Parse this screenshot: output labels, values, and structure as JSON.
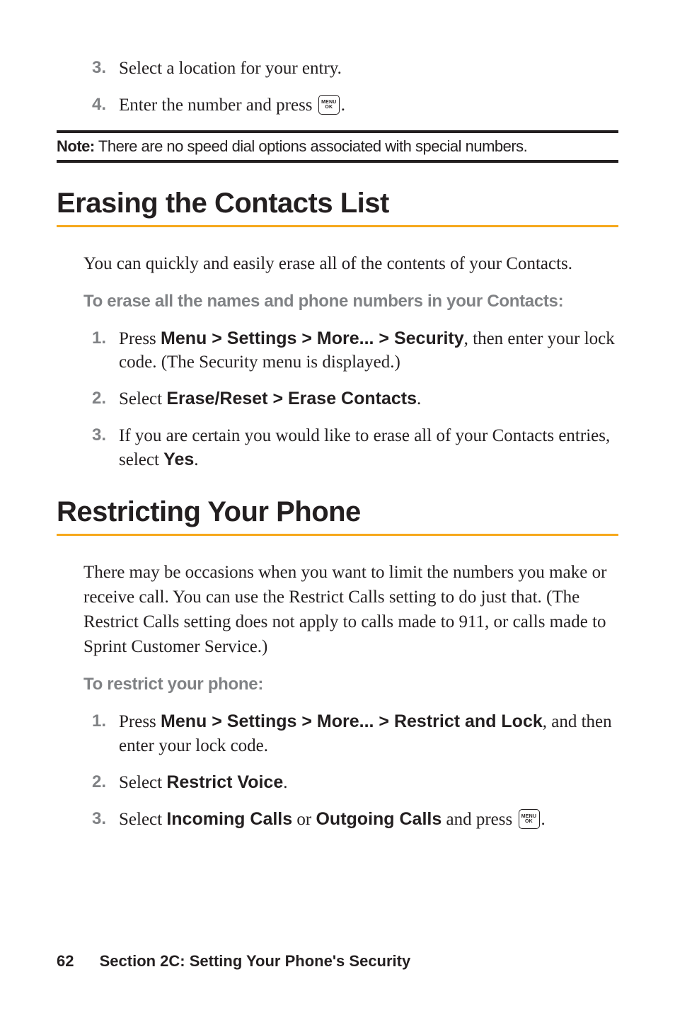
{
  "continued_steps": [
    {
      "num": "3.",
      "text": "Select a location for your entry."
    },
    {
      "num": "4.",
      "text_before": "Enter the number and press ",
      "icon": "menu-ok",
      "text_after": "."
    }
  ],
  "note": {
    "label": "Note:",
    "text": " There are no speed dial options associated with special numbers."
  },
  "section1": {
    "title": "Erasing the Contacts List",
    "intro": "You can quickly and easily erase all of the contents of your Contacts.",
    "subheading": "To erase all the names and phone numbers in your Contacts:",
    "steps": [
      {
        "num": "1.",
        "pre": "Press ",
        "bold": "Menu > Settings > More... > Security",
        "post": ", then enter your lock code. (The Security menu is displayed.)"
      },
      {
        "num": "2.",
        "pre": "Select ",
        "bold": "Erase/Reset > Erase Contacts",
        "post": "."
      },
      {
        "num": "3.",
        "pre": "If you are certain you would like to erase all of your Contacts entries, select ",
        "bold": "Yes",
        "post": "."
      }
    ]
  },
  "section2": {
    "title": "Restricting Your Phone",
    "intro": "There may be occasions when you want to limit the numbers you make or receive call. You can use the Restrict Calls setting to do just that. (The Restrict Calls setting does not apply to calls made to 911, or calls made to Sprint Customer Service.)",
    "subheading": "To restrict your phone:",
    "steps": [
      {
        "num": "1.",
        "pre": "Press ",
        "bold": "Menu > Settings > More... > Restrict and Lock",
        "post": ", and then enter your lock code."
      },
      {
        "num": "2.",
        "pre": "Select ",
        "bold": "Restrict Voice",
        "post": "."
      },
      {
        "num": "3.",
        "pre": "Select ",
        "bold": "Incoming Calls",
        "mid": " or ",
        "bold2": "Outgoing Calls",
        "post": " and press ",
        "icon": "menu-ok",
        "final": "."
      }
    ]
  },
  "footer": {
    "page": "62",
    "section": "Section 2C: Setting Your Phone's Security"
  },
  "icon_text": {
    "line1": "MENU",
    "line2": "OK"
  }
}
